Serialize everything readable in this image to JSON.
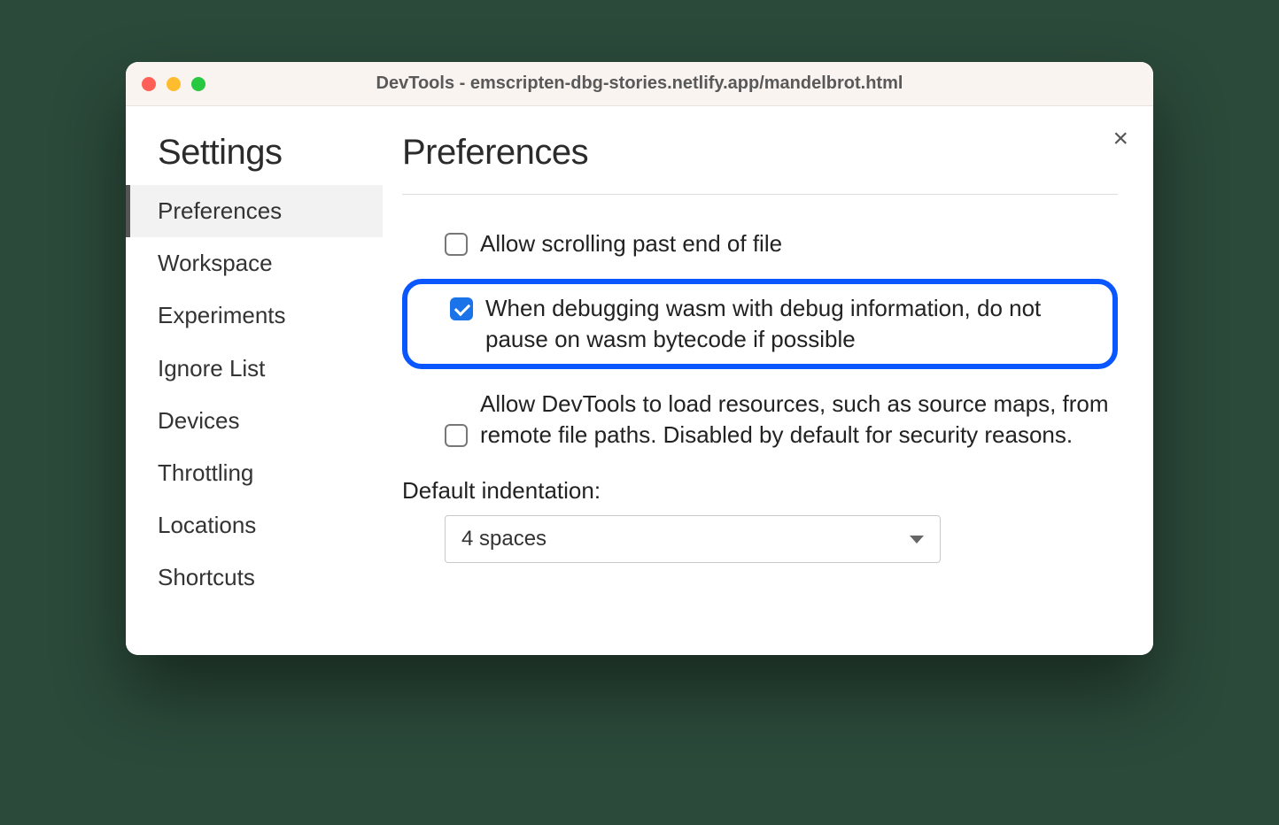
{
  "window": {
    "title": "DevTools - emscripten-dbg-stories.netlify.app/mandelbrot.html"
  },
  "sidebar": {
    "title": "Settings",
    "items": [
      {
        "label": "Preferences",
        "active": true
      },
      {
        "label": "Workspace",
        "active": false
      },
      {
        "label": "Experiments",
        "active": false
      },
      {
        "label": "Ignore List",
        "active": false
      },
      {
        "label": "Devices",
        "active": false
      },
      {
        "label": "Throttling",
        "active": false
      },
      {
        "label": "Locations",
        "active": false
      },
      {
        "label": "Shortcuts",
        "active": false
      }
    ]
  },
  "main": {
    "title": "Preferences",
    "options": [
      {
        "label": "Allow scrolling past end of file",
        "checked": false,
        "highlight": false
      },
      {
        "label": "When debugging wasm with debug information, do not pause on wasm bytecode if possible",
        "checked": true,
        "highlight": true
      },
      {
        "label": "Allow DevTools to load resources, such as source maps, from remote file paths. Disabled by default for security reasons.",
        "checked": false,
        "highlight": false
      }
    ],
    "indent_label": "Default indentation:",
    "indent_value": "4 spaces"
  }
}
